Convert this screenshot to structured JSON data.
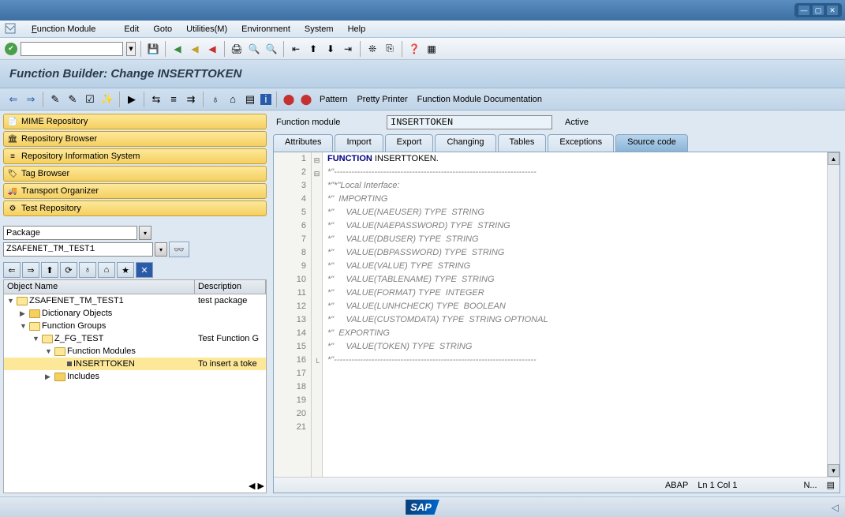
{
  "menu": {
    "m1": "Function Module",
    "m2": "Edit",
    "m3": "Goto",
    "m4": "Utilities(M)",
    "m5": "Environment",
    "m6": "System",
    "m7": "Help"
  },
  "title": "Function Builder: Change INSERTTOKEN",
  "toolbar2": {
    "pattern": "Pattern",
    "pretty": "Pretty Printer",
    "doc": "Function Module Documentation"
  },
  "nav": {
    "n1": "MIME Repository",
    "n2": "Repository Browser",
    "n3": "Repository Information System",
    "n4": "Tag Browser",
    "n5": "Transport Organizer",
    "n6": "Test Repository"
  },
  "package_label": "Package",
  "package_value": "ZSAFENET_TM_TEST1",
  "tree_hdr": {
    "c1": "Object Name",
    "c2": "Description"
  },
  "tree": [
    {
      "indent": 0,
      "exp": "▼",
      "ico": "folder-open",
      "name": "ZSAFENET_TM_TEST1",
      "desc": "test package",
      "sel": false
    },
    {
      "indent": 1,
      "exp": "▶",
      "ico": "folder",
      "name": "Dictionary Objects",
      "desc": "",
      "sel": false
    },
    {
      "indent": 1,
      "exp": "▼",
      "ico": "folder-open",
      "name": "Function Groups",
      "desc": "",
      "sel": false
    },
    {
      "indent": 2,
      "exp": "▼",
      "ico": "folder-open",
      "name": "Z_FG_TEST",
      "desc": "Test Function G",
      "sel": false
    },
    {
      "indent": 3,
      "exp": "▼",
      "ico": "folder-open",
      "name": "Function Modules",
      "desc": "",
      "sel": false
    },
    {
      "indent": 4,
      "exp": "",
      "ico": "leaf",
      "name": "INSERTTOKEN",
      "desc": "To insert a toke",
      "sel": true
    },
    {
      "indent": 3,
      "exp": "▶",
      "ico": "folder",
      "name": "Includes",
      "desc": "",
      "sel": false
    }
  ],
  "fm": {
    "label": "Function module",
    "value": "INSERTTOKEN",
    "status": "Active"
  },
  "tabs": {
    "t1": "Attributes",
    "t2": "Import",
    "t3": "Export",
    "t4": "Changing",
    "t5": "Tables",
    "t6": "Exceptions",
    "t7": "Source code"
  },
  "chart_data": null,
  "code": {
    "lines": [
      {
        "n": 1,
        "fold": "⊟",
        "cls": "",
        "html": "<span class='kw'>FUNCTION</span> INSERTTOKEN."
      },
      {
        "n": 2,
        "fold": "⊟",
        "cls": "cm",
        "text": "*\"----------------------------------------------------------------------"
      },
      {
        "n": 3,
        "fold": "",
        "cls": "cm",
        "text": "*\"*\"Local Interface:"
      },
      {
        "n": 4,
        "fold": "",
        "cls": "cm",
        "text": "*\"  IMPORTING"
      },
      {
        "n": 5,
        "fold": "",
        "cls": "cm",
        "text": "*\"     VALUE(NAEUSER) TYPE  STRING"
      },
      {
        "n": 6,
        "fold": "",
        "cls": "cm",
        "text": "*\"     VALUE(NAEPASSWORD) TYPE  STRING"
      },
      {
        "n": 7,
        "fold": "",
        "cls": "cm",
        "text": "*\"     VALUE(DBUSER) TYPE  STRING"
      },
      {
        "n": 8,
        "fold": "",
        "cls": "cm",
        "text": "*\"     VALUE(DBPASSWORD) TYPE  STRING"
      },
      {
        "n": 9,
        "fold": "",
        "cls": "cm",
        "text": "*\"     VALUE(VALUE) TYPE  STRING"
      },
      {
        "n": 10,
        "fold": "",
        "cls": "cm",
        "text": "*\"     VALUE(TABLENAME) TYPE  STRING"
      },
      {
        "n": 11,
        "fold": "",
        "cls": "cm",
        "text": "*\"     VALUE(FORMAT) TYPE  INTEGER"
      },
      {
        "n": 12,
        "fold": "",
        "cls": "cm",
        "text": "*\"     VALUE(LUNHCHECK) TYPE  BOOLEAN"
      },
      {
        "n": 13,
        "fold": "",
        "cls": "cm",
        "text": "*\"     VALUE(CUSTOMDATA) TYPE  STRING OPTIONAL"
      },
      {
        "n": 14,
        "fold": "",
        "cls": "cm",
        "text": "*\"  EXPORTING"
      },
      {
        "n": 15,
        "fold": "",
        "cls": "cm",
        "text": "*\"     VALUE(TOKEN) TYPE  STRING"
      },
      {
        "n": 16,
        "fold": "└",
        "cls": "cm",
        "text": "*\"----------------------------------------------------------------------"
      },
      {
        "n": 17,
        "fold": "",
        "cls": "",
        "text": ""
      },
      {
        "n": 18,
        "fold": "",
        "cls": "",
        "text": ""
      },
      {
        "n": 19,
        "fold": "",
        "cls": "",
        "text": ""
      },
      {
        "n": 20,
        "fold": "",
        "cls": "",
        "text": ""
      },
      {
        "n": 21,
        "fold": "",
        "cls": "",
        "text": ""
      }
    ]
  },
  "status": {
    "lang": "ABAP",
    "pos": "Ln   1 Col   1",
    "mod": "N..."
  }
}
